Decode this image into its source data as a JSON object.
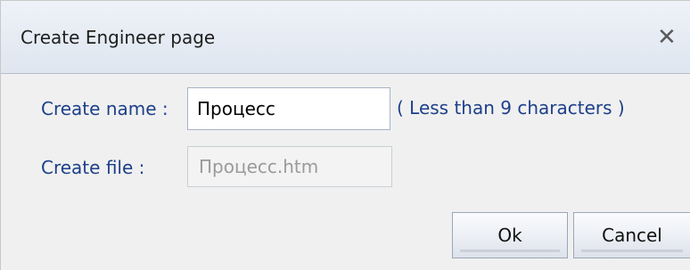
{
  "dialog": {
    "title": "Create Engineer page",
    "close_glyph": "✕"
  },
  "form": {
    "name_label": "Create name :",
    "name_value": "Процесс",
    "name_hint": "( Less than 9 characters )",
    "file_label": "Create file :",
    "file_value": "Процесс.htm"
  },
  "buttons": {
    "ok_label": "Ok",
    "cancel_label": "Cancel"
  }
}
